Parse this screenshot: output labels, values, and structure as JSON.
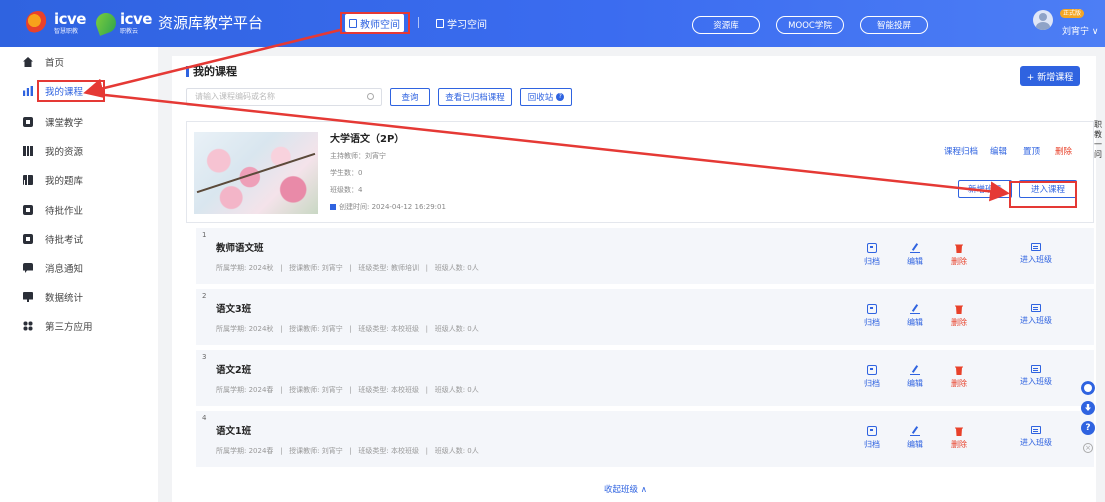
{
  "header": {
    "logo_brand": "icve",
    "logo_brand_sub": "智慧职教",
    "logo_brand2": "icve",
    "logo_brand2_sub": "职教云",
    "platform_title": "资源库教学平台",
    "tabs": [
      {
        "label": "教师空间",
        "active": true
      },
      {
        "label": "学习空间",
        "active": false
      }
    ],
    "pills": [
      "资源库",
      "MOOC学院",
      "智能投屏"
    ],
    "user_badge": "正式版",
    "user_name": "刘宵宁 ∨"
  },
  "sidebar": {
    "items": [
      {
        "label": "首页",
        "icon": "home-icon",
        "active": false
      },
      {
        "label": "我的课程",
        "icon": "course-chart-icon",
        "active": true
      },
      {
        "label": "课堂教学",
        "icon": "classroom-icon",
        "active": false
      },
      {
        "label": "我的资源",
        "icon": "resource-icon",
        "active": false
      },
      {
        "label": "我的题库",
        "icon": "question-bank-icon",
        "active": false
      },
      {
        "label": "待批作业",
        "icon": "homework-icon",
        "active": false
      },
      {
        "label": "待批考试",
        "icon": "exam-icon",
        "active": false
      },
      {
        "label": "消息通知",
        "icon": "message-icon",
        "active": false
      },
      {
        "label": "数据统计",
        "icon": "statistics-icon",
        "active": false
      },
      {
        "label": "第三方应用",
        "icon": "apps-icon",
        "active": false
      }
    ]
  },
  "main": {
    "title": "我的课程",
    "search_placeholder": "请输入课程编码或名称",
    "btn_query": "查询",
    "btn_archived": "查看已归档课程",
    "btn_recycle": "回收站",
    "btn_add": "+ 新增课程",
    "course": {
      "name": "大学语文（2P）",
      "teacher": "主持教师：刘宵宁",
      "students": "学生数：0",
      "classes": "班级数：4",
      "created": "创建时间: 2024-04-12 16:29:01",
      "link_archive": "课程归档",
      "link_edit": "编辑",
      "link_top": "置顶",
      "link_delete": "删除",
      "btn_add_class": "新增班级",
      "btn_enter_course": "进入课程"
    },
    "class_actions": {
      "archive": "归档",
      "edit": "编辑",
      "delete": "删除",
      "enter": "进入班级"
    },
    "classes": [
      {
        "index": "1",
        "name": "教师语文班",
        "meta": "所属学期: 2024秋   |   授课教师: 刘宵宁   |   班级类型: 教师培训   |   班级人数: 0人"
      },
      {
        "index": "2",
        "name": "语文3班",
        "meta": "所属学期: 2024秋   |   授课教师: 刘宵宁   |   班级类型: 本校班级   |   班级人数: 0人"
      },
      {
        "index": "3",
        "name": "语文2班",
        "meta": "所属学期: 2024春   |   授课教师: 刘宵宁   |   班级类型: 本校班级   |   班级人数: 0人"
      },
      {
        "index": "4",
        "name": "语文1班",
        "meta": "所属学期: 2024春   |   授课教师: 刘宵宁   |   班级类型: 本校班级   |   班级人数: 0人"
      }
    ],
    "collapse_label": "收起班级 ∧"
  },
  "right_edge_text": "职教一问",
  "colors": {
    "primary": "#2f63e0",
    "danger": "#e8412a",
    "annotation": "#e53935"
  }
}
